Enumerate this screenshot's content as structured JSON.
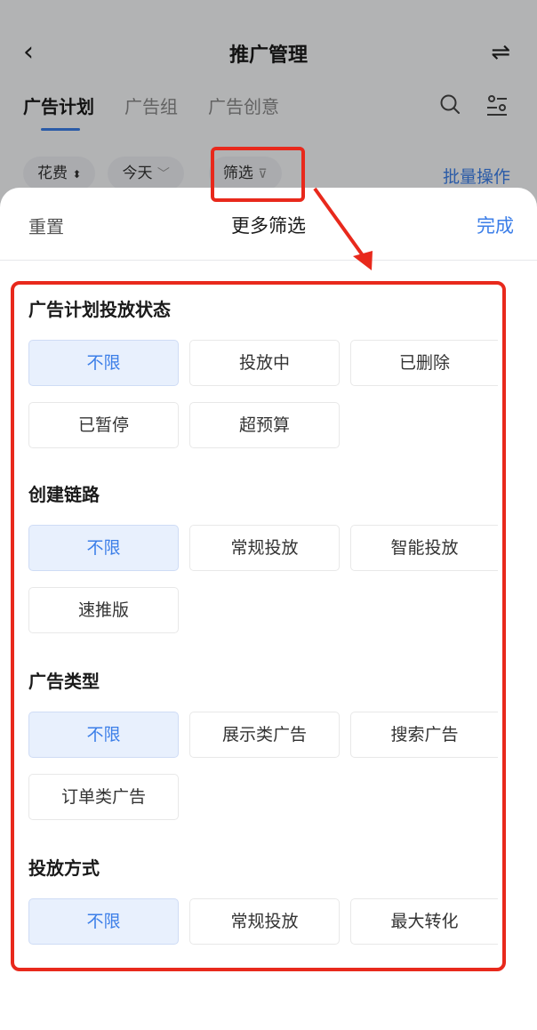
{
  "nav": {
    "back_icon": "chevron-left-icon",
    "title": "推广管理",
    "switch_icon": "swap-arrows-icon",
    "tabs": [
      {
        "label": "广告计划",
        "active": true
      },
      {
        "label": "广告组",
        "active": false
      },
      {
        "label": "广告创意",
        "active": false
      }
    ],
    "search_icon": "search-icon",
    "settings_icon": "sliders-icon"
  },
  "filters": {
    "sort_chip": "花费",
    "date_chip": "今天",
    "filter_chip": "筛选",
    "batch": "批量操作"
  },
  "sheet": {
    "reset": "重置",
    "title": "更多筛选",
    "done": "完成",
    "sections": [
      {
        "title": "广告计划投放状态",
        "options": [
          {
            "label": "不限",
            "selected": true
          },
          {
            "label": "投放中",
            "selected": false
          },
          {
            "label": "已删除",
            "selected": false
          },
          {
            "label": "已暂停",
            "selected": false
          },
          {
            "label": "超预算",
            "selected": false
          }
        ]
      },
      {
        "title": "创建链路",
        "options": [
          {
            "label": "不限",
            "selected": true
          },
          {
            "label": "常规投放",
            "selected": false
          },
          {
            "label": "智能投放",
            "selected": false
          },
          {
            "label": "速推版",
            "selected": false
          }
        ]
      },
      {
        "title": "广告类型",
        "options": [
          {
            "label": "不限",
            "selected": true
          },
          {
            "label": "展示类广告",
            "selected": false
          },
          {
            "label": "搜索广告",
            "selected": false
          },
          {
            "label": "订单类广告",
            "selected": false
          }
        ]
      },
      {
        "title": "投放方式",
        "options": [
          {
            "label": "不限",
            "selected": true
          },
          {
            "label": "常规投放",
            "selected": false
          },
          {
            "label": "最大转化",
            "selected": false
          }
        ]
      }
    ]
  },
  "colors": {
    "accent": "#3b7ee8",
    "selected_bg": "#e8f0fd",
    "annotation": "#e8291c"
  }
}
